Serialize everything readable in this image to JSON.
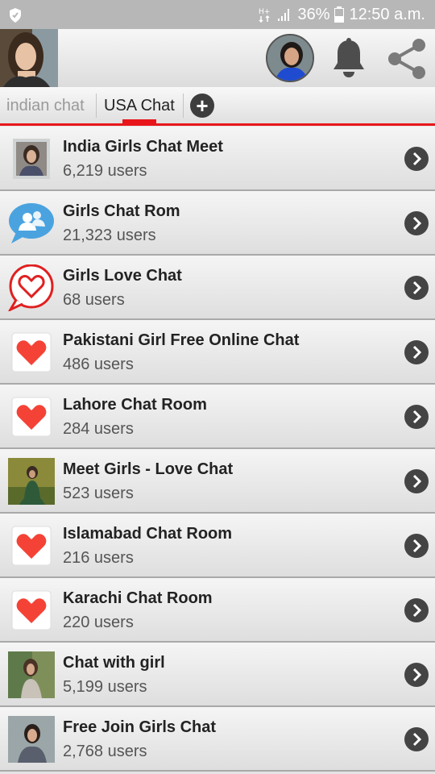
{
  "status_bar": {
    "battery_percent": "36%",
    "time": "12:50 a.m.",
    "icons": [
      "shield-icon",
      "network-type-icon",
      "signal-icon",
      "battery-icon"
    ]
  },
  "header": {
    "icons": [
      "user-avatar",
      "contact-avatar",
      "bell-icon",
      "share-icon"
    ]
  },
  "tabs": [
    {
      "label": "indian chat",
      "selected": false
    },
    {
      "label": "USA Chat",
      "selected": true
    }
  ],
  "add_tab_label": "+",
  "colors": {
    "accent": "#e8161b",
    "chevron": "#444444",
    "heart": "#f44336",
    "bubble_blue": "#4aa3df"
  },
  "rooms": [
    {
      "title": "India Girls Chat Meet",
      "users": "6,219 users",
      "thumb": "photo"
    },
    {
      "title": "Girls Chat Rom",
      "users": "21,323 users",
      "thumb": "group-bubble"
    },
    {
      "title": "Girls Love Chat",
      "users": "68 users",
      "thumb": "heart-bubble"
    },
    {
      "title": "Pakistani Girl Free Online Chat",
      "users": "486 users",
      "thumb": "heart"
    },
    {
      "title": "Lahore Chat Room",
      "users": "284 users",
      "thumb": "heart"
    },
    {
      "title": "Meet Girls - Love Chat",
      "users": "523 users",
      "thumb": "photo"
    },
    {
      "title": "Islamabad Chat Room",
      "users": "216 users",
      "thumb": "heart"
    },
    {
      "title": "Karachi Chat Room",
      "users": "220 users",
      "thumb": "heart"
    },
    {
      "title": "Chat with girl",
      "users": "5,199 users",
      "thumb": "photo"
    },
    {
      "title": "Free Join Girls Chat",
      "users": "2,768 users",
      "thumb": "photo"
    }
  ]
}
